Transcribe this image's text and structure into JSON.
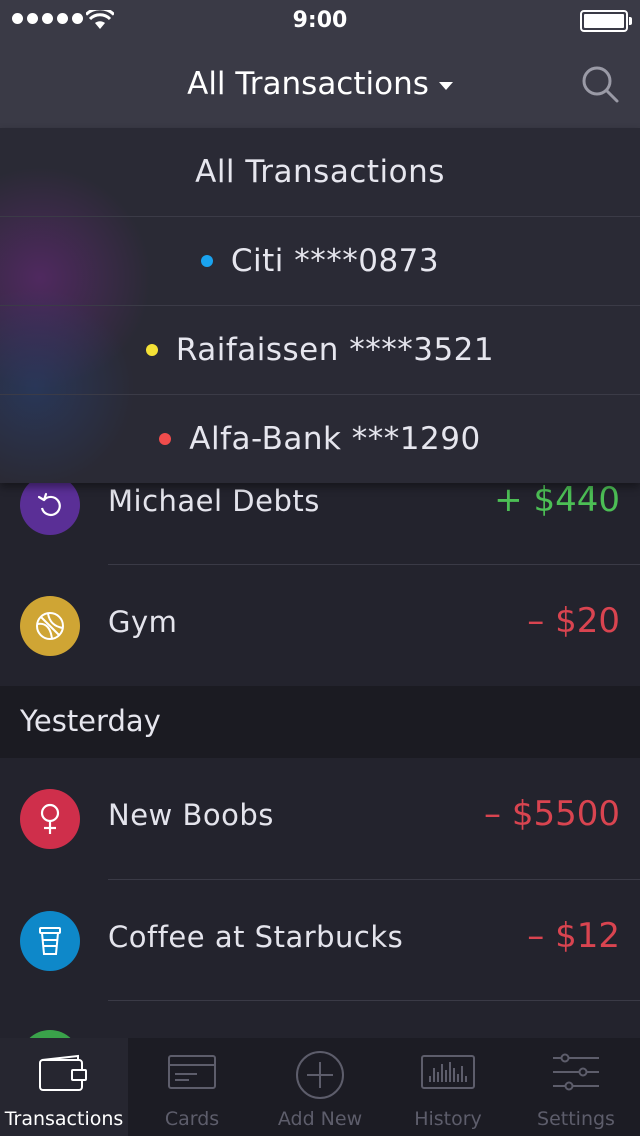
{
  "status_bar": {
    "time": "9:00",
    "signal_dots": 5,
    "battery_level": 1.0
  },
  "header": {
    "title": "All Transactions",
    "dropdown_icon": "caret-down-icon",
    "search_icon": "search-icon"
  },
  "dropdown": {
    "items": [
      {
        "label": "All Transactions",
        "color": null
      },
      {
        "label": "Citi ****0873",
        "color": "#1aa3ef"
      },
      {
        "label": "Raifaissen ****3521",
        "color": "#f4e136"
      },
      {
        "label": "Alfa-Bank ***1290",
        "color": "#f04c4c"
      }
    ]
  },
  "transactions_top": [
    {
      "name": "Michael Debts",
      "amount": "+ $440",
      "type": "income",
      "icon": "refresh-icon",
      "icon_color": "#5a2f96"
    },
    {
      "name": "Gym",
      "amount": "– $20",
      "type": "expense",
      "icon": "basketball-icon",
      "icon_color": "#cfa534"
    }
  ],
  "section": {
    "label": "Yesterday"
  },
  "transactions_yesterday": [
    {
      "name": "New Boobs",
      "amount": "– $5500",
      "type": "expense",
      "icon": "female-icon",
      "icon_color": "#cf2f4b"
    },
    {
      "name": "Coffee at Starbucks",
      "amount": "– $12",
      "type": "expense",
      "icon": "coffee-cup-icon",
      "icon_color": "#0e88c9"
    }
  ],
  "tab_bar": {
    "active": 0,
    "tabs": [
      {
        "label": "Transactions",
        "icon": "wallet-icon"
      },
      {
        "label": "Cards",
        "icon": "card-icon"
      },
      {
        "label": "Add New",
        "icon": "plus-circle-icon"
      },
      {
        "label": "History",
        "icon": "history-icon"
      },
      {
        "label": "Settings",
        "icon": "sliders-icon"
      }
    ]
  },
  "colors": {
    "income": "#4cbf55",
    "expense": "#d94450",
    "background": "#23232d",
    "header": "#3a3a46"
  }
}
